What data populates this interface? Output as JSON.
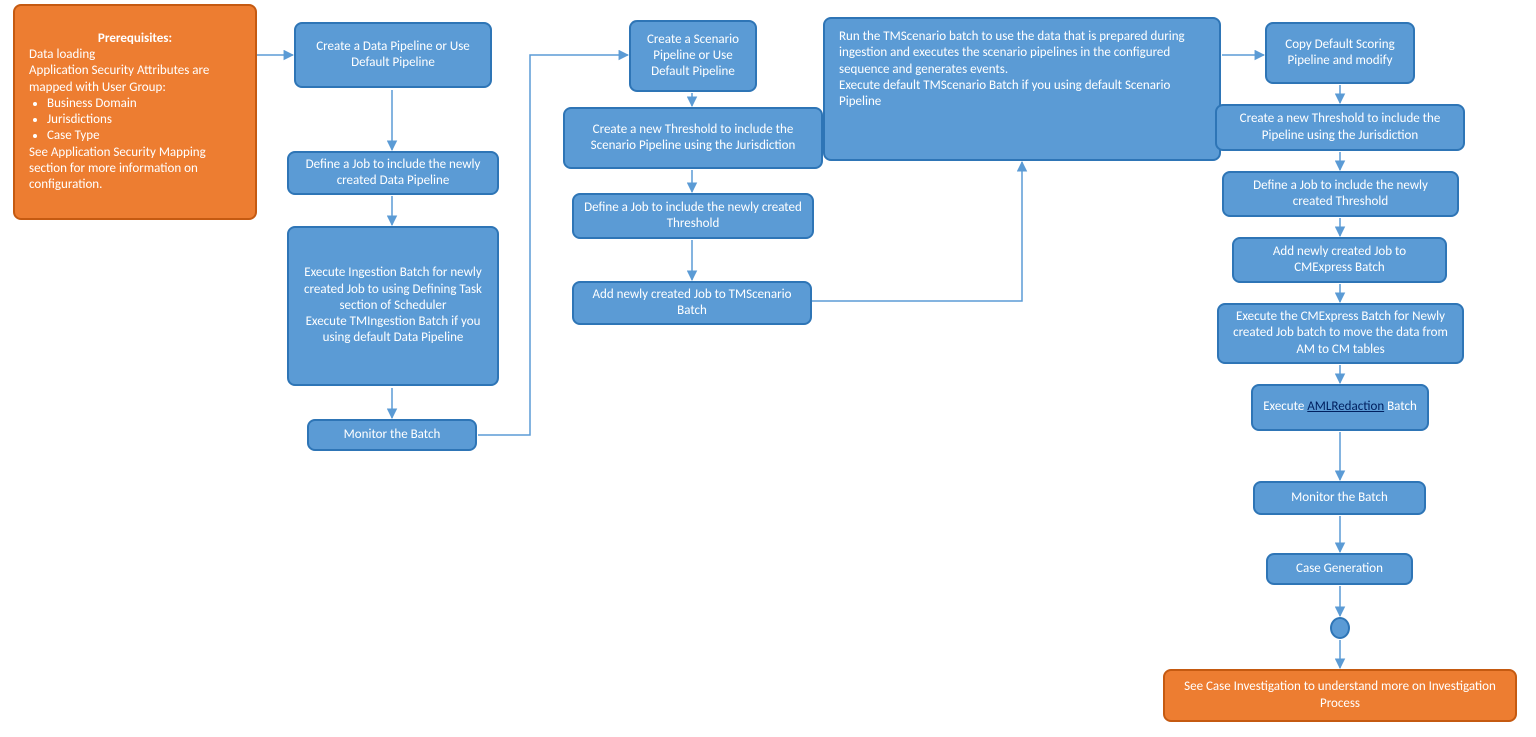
{
  "prereq": {
    "title": "Prerequisites:",
    "line1": "Data loading",
    "line2": "Application Security Attributes are mapped with User Group:",
    "bullets": [
      "Business Domain",
      "Jurisdictions",
      "Case Type"
    ],
    "line3": "See Application Security Mapping section for more information on configuration."
  },
  "col1": {
    "n1": "Create a Data Pipeline or Use Default Pipeline",
    "n2": "Define a Job to include the newly created Data Pipeline",
    "n3": "Execute Ingestion Batch for newly created Job to using Defining Task section of Scheduler\nExecute TMIngestion Batch if you using default Data Pipeline",
    "n4": "Monitor the Batch"
  },
  "col2": {
    "n1": "Create a Scenario Pipeline or Use Default Pipeline",
    "n2": "Create a new Threshold to include the Scenario Pipeline using the Jurisdiction",
    "n3": "Define a Job to include the newly created Threshold",
    "n4": "Add newly created Job to TMScenario Batch"
  },
  "tmscenario": "Run the TMScenario batch to use the data that is prepared during ingestion and executes the scenario pipelines in the configured sequence and generates events.\nExecute default TMScenario Batch if you using default Scenario Pipeline",
  "col3": {
    "n1": "Copy Default Scoring Pipeline and modify",
    "n2": "Create a new Threshold to include the Pipeline using the Jurisdiction",
    "n3": "Define a Job to include the newly created Threshold",
    "n4": "Add newly created Job to CMExpress Batch",
    "n5": "Execute the CMExpress Batch for Newly created Job batch to move the data from AM to CM tables",
    "n6_pre": "Execute ",
    "n6_link": "AMLRedaction",
    "n6_post": " Batch",
    "n7": "Monitor the Batch",
    "n8": "Case Generation"
  },
  "final": "See Case Investigation to understand more on Investigation Process"
}
